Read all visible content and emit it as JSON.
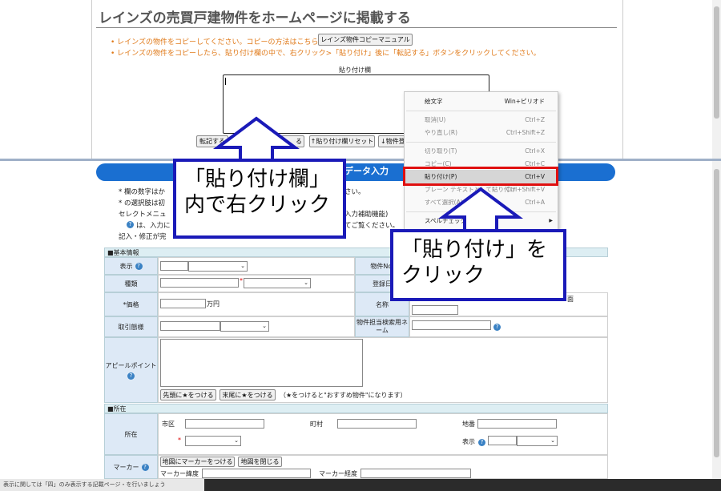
{
  "page_title": "レインズの売買戸建物件をホームページに掲載する",
  "instructions": {
    "line1": "レインズの物件をコピーしてください。コピーの方法はこちら→",
    "manual_button": "レインズ物件コピーマニュアル",
    "line2": "レインズの物件をコピーしたら、貼り付け欄の中で、右クリック>「貼り付け」後に「転記する」ボタンをクリックしてください。"
  },
  "paste_field": {
    "label": "貼り付け欄",
    "value": ""
  },
  "action_buttons": {
    "transfer": "転記する",
    "hidden_fragment": "る",
    "reset": "↑貼り付け欄リセット",
    "register": "↓物件登録"
  },
  "context_menu": {
    "items": [
      {
        "label": "絵文字",
        "shortcut": "Win+ピリオド",
        "enabled": true
      },
      {
        "label": "取消(U)",
        "shortcut": "Ctrl+Z",
        "enabled": false
      },
      {
        "label": "やり直し(R)",
        "shortcut": "Ctrl+Shift+Z",
        "enabled": false
      },
      {
        "label": "切り取り(T)",
        "shortcut": "Ctrl+X",
        "enabled": false
      },
      {
        "label": "コピー(C)",
        "shortcut": "Ctrl+C",
        "enabled": false
      },
      {
        "label": "貼り付け(P)",
        "shortcut": "Ctrl+V",
        "enabled": true,
        "highlighted": true
      },
      {
        "label": "プレーン テキストとして貼り付け",
        "shortcut": "Ctrl+Shift+V",
        "enabled": false
      },
      {
        "label": "すべて選択(A)",
        "shortcut": "Ctrl+A",
        "enabled": false
      },
      {
        "label": "スペルチェック(S)",
        "shortcut": "▶",
        "enabled": true
      }
    ]
  },
  "form": {
    "banner_title": "データ入力",
    "notes": [
      "* 欄の数字はか",
      "* の選択肢は初",
      "セレクトメニュ",
      "は、入力に",
      "記入・修正が完"
    ],
    "notes_right": [
      "さい。",
      "入力補助機能)",
      "てご覧ください。"
    ],
    "basic_section": "■基本情報",
    "labels": {
      "display": "表示",
      "type": "種類",
      "price": "*価格",
      "price_unit": "万円",
      "transaction": "取引態様",
      "appeal": "アピールポイント",
      "property_no": "物件No.",
      "register_date": "登録日",
      "name": "名称",
      "name_extra": "面",
      "staff_search": "物件担当検索用ネーム"
    },
    "appeal_buttons": {
      "star_start": "先頭に★をつける",
      "star_end": "末尾に★をつける",
      "star_note": "（★をつけると\"おすすめ物件\"になります）"
    },
    "location_section": "■所在",
    "location": {
      "label": "所在",
      "city": "市区",
      "town": "町村",
      "lot": "地番",
      "display": "表示"
    },
    "marker": {
      "label": "マーカー",
      "set_button": "地図にマーカーをつける",
      "close_button": "地図を閉じる",
      "lat": "マーカー緯度",
      "lng": "マーカー経度"
    }
  },
  "callouts": {
    "left_line1": "「貼り付け欄」",
    "left_line2": "内で右クリック",
    "right_line1": "「貼り付け」を",
    "right_line2": "クリック"
  },
  "taskbar_text": "表示に関しては「四」のみ表示する記載ページ・を行いましょう",
  "colors": {
    "banner": "#1a6fd1",
    "arrow": "#1a1ab8",
    "highlight_box": "#e01010",
    "bullet_text": "#e07a1a"
  }
}
